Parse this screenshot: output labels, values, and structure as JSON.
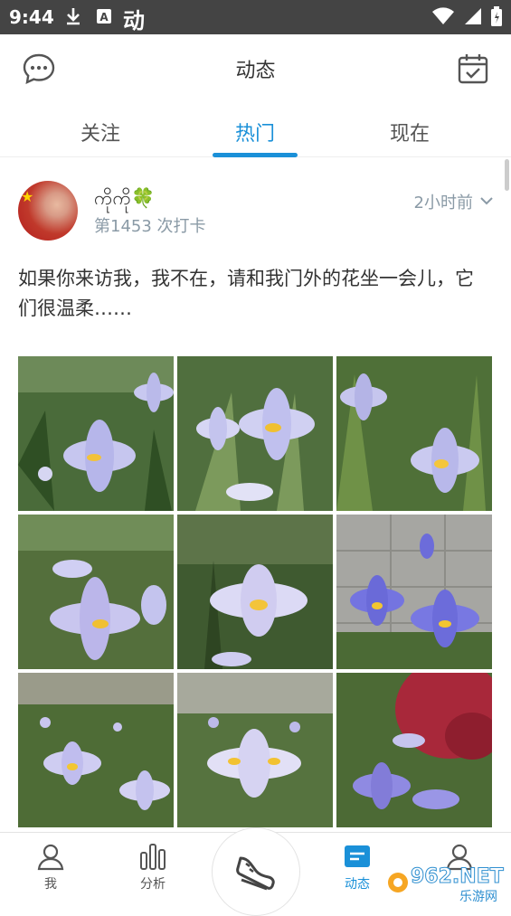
{
  "status_bar": {
    "time": "9:44",
    "app_glyph": "动"
  },
  "header": {
    "title": "动态"
  },
  "tabs": [
    {
      "label": "关注",
      "active": false
    },
    {
      "label": "热门",
      "active": true
    },
    {
      "label": "现在",
      "active": false
    }
  ],
  "post": {
    "username": "ကိုကို",
    "username_emoji": "🍀",
    "checkin": "第1453 次打卡",
    "time_ago": "2小时前",
    "text": "如果你来访我，我不在，请和我门外的花坐一会儿，它们很温柔……",
    "photo_count": 9
  },
  "bottom_nav": {
    "me": "我",
    "analysis": "分析",
    "feed": "动态",
    "fourth": ""
  },
  "watermark": {
    "text": "962.NET",
    "sub": "乐游网"
  },
  "colors": {
    "accent": "#1a90d8",
    "status_bar": "#444444",
    "muted": "#8a9aa6"
  }
}
